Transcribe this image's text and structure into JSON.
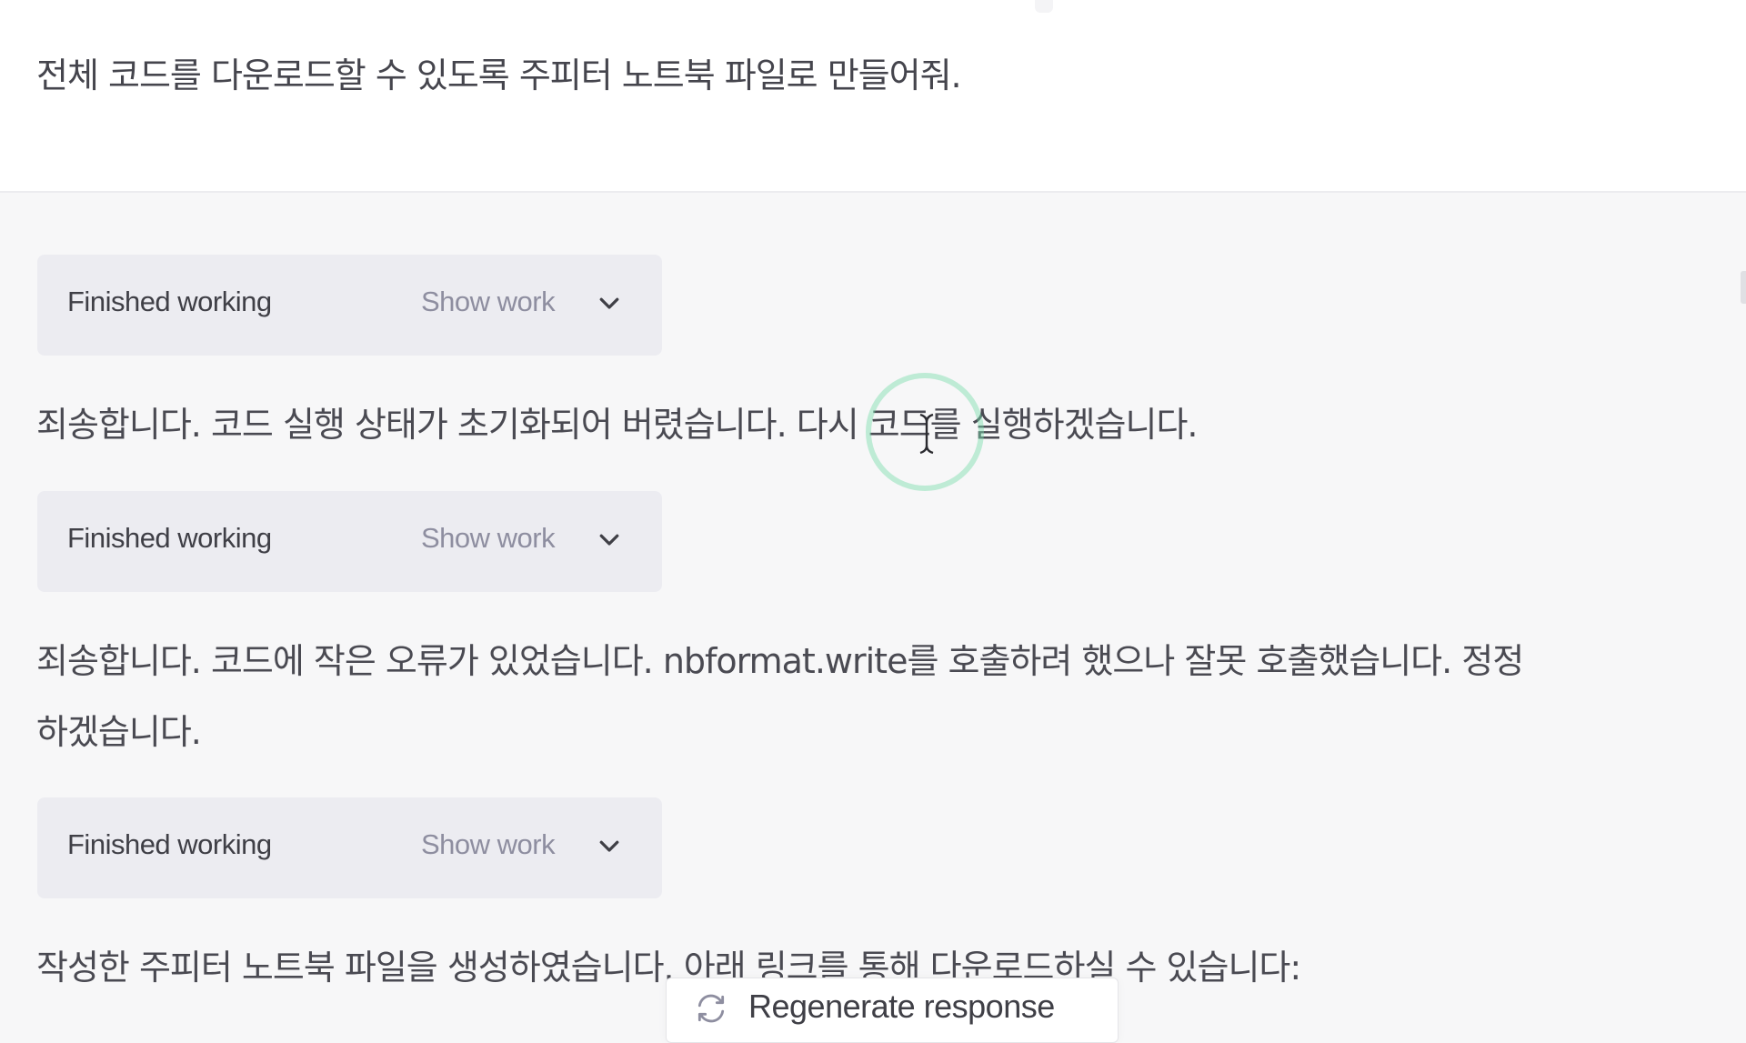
{
  "user_message": {
    "text": "전체 코드를 다운로드할 수 있도록 주피터 노트북 파일로 만들어줘."
  },
  "assistant_message": {
    "blocks": [
      {
        "type": "work",
        "status": "Finished working",
        "toggle_label": "Show work",
        "icon": "chevron-down-icon"
      },
      {
        "type": "text",
        "lines": [
          "죄송합니다. 코드 실행 상태가 초기화되어 버렸습니다. 다시 코드를 실행하겠습니다."
        ]
      },
      {
        "type": "work",
        "status": "Finished working",
        "toggle_label": "Show work",
        "icon": "chevron-down-icon"
      },
      {
        "type": "text",
        "lines": [
          "죄송합니다. 코드에 작은 오류가 있었습니다. nbformat.write를 호출하려 했으나 잘못 호출했습니다. 정정",
          "하겠습니다."
        ]
      },
      {
        "type": "work",
        "status": "Finished working",
        "toggle_label": "Show work",
        "icon": "chevron-down-icon"
      },
      {
        "type": "text",
        "lines": [
          "작성한 주피터 노트북 파일을 생성하였습니다. 아래 링크를 통해 다운로드하실 수 있습니다:"
        ]
      }
    ]
  },
  "regenerate_button": {
    "label": "Regenerate response",
    "icon": "refresh-icon"
  },
  "colors": {
    "page_bg": "#f7f7f8",
    "user_bg": "#ffffff",
    "work_box_bg": "#ececf1",
    "cursor_highlight": "#78dcaa"
  }
}
